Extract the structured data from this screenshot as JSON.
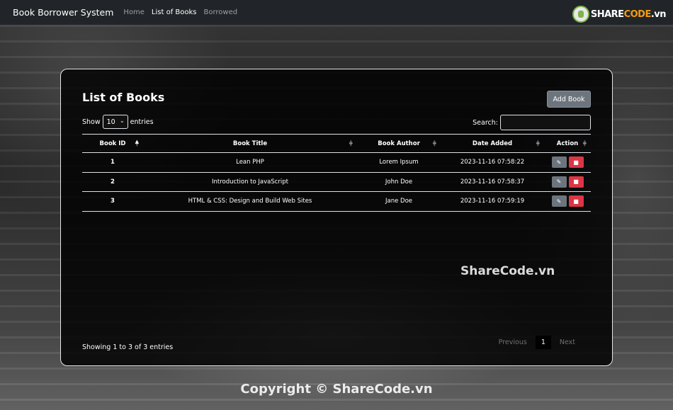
{
  "navbar": {
    "brand": "Book Borrower System",
    "links": [
      "Home",
      "List of Books",
      "Borrowed"
    ],
    "logo": {
      "main": "SHARE",
      "accent": "CODE",
      "suffix": ".vn"
    }
  },
  "card": {
    "title": "List of Books",
    "add_button": "Add Book",
    "show_label": "Show",
    "entries_label": "entries",
    "page_size": "10",
    "search_label": "Search:",
    "search_value": "",
    "columns": [
      "Book ID",
      "Book Title",
      "Book Author",
      "Date Added",
      "Action"
    ],
    "rows": [
      {
        "id": "1",
        "title": "Lean PHP",
        "author": "Lorem Ipsum",
        "date": "2023-11-16 07:58:22"
      },
      {
        "id": "2",
        "title": "Introduction to JavaScript",
        "author": "John Doe",
        "date": "2023-11-16 07:58:37"
      },
      {
        "id": "3",
        "title": "HTML & CSS: Design and Build Web Sites",
        "author": "Jane Doe",
        "date": "2023-11-16 07:59:19"
      }
    ],
    "info": "Showing 1 to 3 of 3 entries",
    "pagination": {
      "previous": "Previous",
      "current": "1",
      "next": "Next"
    }
  },
  "watermark": "ShareCode.vn",
  "copyright": "Copyright © ShareCode.vn",
  "icons": {
    "edit": "pencil-icon",
    "delete": "trash-icon",
    "sort": "sort-icon"
  },
  "colors": {
    "navbar": "#212529",
    "edit": "#6c757d",
    "delete": "#dc3545"
  }
}
